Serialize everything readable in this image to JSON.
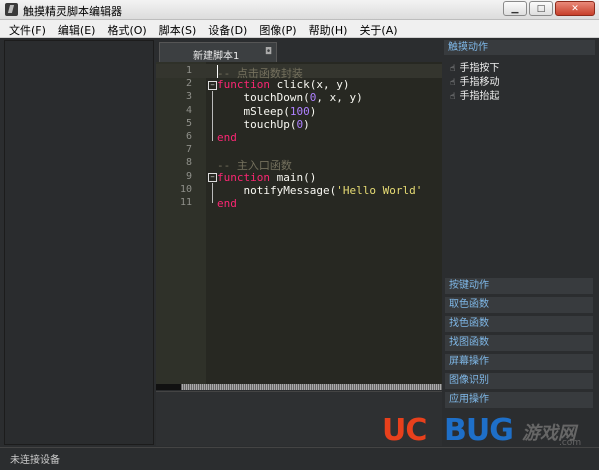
{
  "window": {
    "title": "触摸精灵脚本编辑器"
  },
  "window_buttons": {
    "minimize": "▁",
    "maximize": "□",
    "close": "✕"
  },
  "menu": [
    "文件(F)",
    "编辑(E)",
    "格式(O)",
    "脚本(S)",
    "设备(D)",
    "图像(P)",
    "帮助(H)",
    "关于(A)"
  ],
  "tab": {
    "label": "新建脚本1",
    "close": "◘"
  },
  "editor": {
    "line_numbers": [
      "1",
      "2",
      "3",
      "4",
      "5",
      "6",
      "7",
      "8",
      "9",
      "10",
      "11"
    ],
    "lines": [
      [
        {
          "t": "-- 点击函数封装",
          "c": "cm"
        }
      ],
      [
        {
          "t": "function",
          "c": "kw"
        },
        {
          "t": " click(x, y)",
          "c": "pl"
        }
      ],
      [
        {
          "t": "    touchDown(",
          "c": "pl"
        },
        {
          "t": "0",
          "c": "nm"
        },
        {
          "t": ", x, y)",
          "c": "pl"
        }
      ],
      [
        {
          "t": "    mSleep(",
          "c": "pl"
        },
        {
          "t": "100",
          "c": "nm"
        },
        {
          "t": ")",
          "c": "pl"
        }
      ],
      [
        {
          "t": "    touchUp(",
          "c": "pl"
        },
        {
          "t": "0",
          "c": "nm"
        },
        {
          "t": ")",
          "c": "pl"
        }
      ],
      [
        {
          "t": "end",
          "c": "kw"
        }
      ],
      [],
      [
        {
          "t": "-- 主入口函数",
          "c": "cm"
        }
      ],
      [
        {
          "t": "function",
          "c": "kw"
        },
        {
          "t": " main()",
          "c": "pl"
        }
      ],
      [
        {
          "t": "    notifyMessage(",
          "c": "pl"
        },
        {
          "t": "'Hello World'",
          "c": "st"
        }
      ],
      [
        {
          "t": "end",
          "c": "kw"
        }
      ]
    ]
  },
  "right_panel": {
    "header": "触摸动作",
    "items": [
      "手指按下",
      "手指移动",
      "手指抬起"
    ],
    "categories": [
      "按键动作",
      "取色函数",
      "找色函数",
      "找图函数",
      "屏幕操作",
      "图像识别",
      "应用操作"
    ]
  },
  "status": {
    "text": "未连接设备"
  },
  "watermark": {
    "uc": "UC",
    "bug": "BUG",
    "cn": "游戏网",
    "domain": ".com"
  },
  "colors": {
    "keyword": "#f92672",
    "comment": "#75715e",
    "number": "#ae81ff",
    "string": "#e6db74",
    "panel_link": "#7fb8e8"
  }
}
